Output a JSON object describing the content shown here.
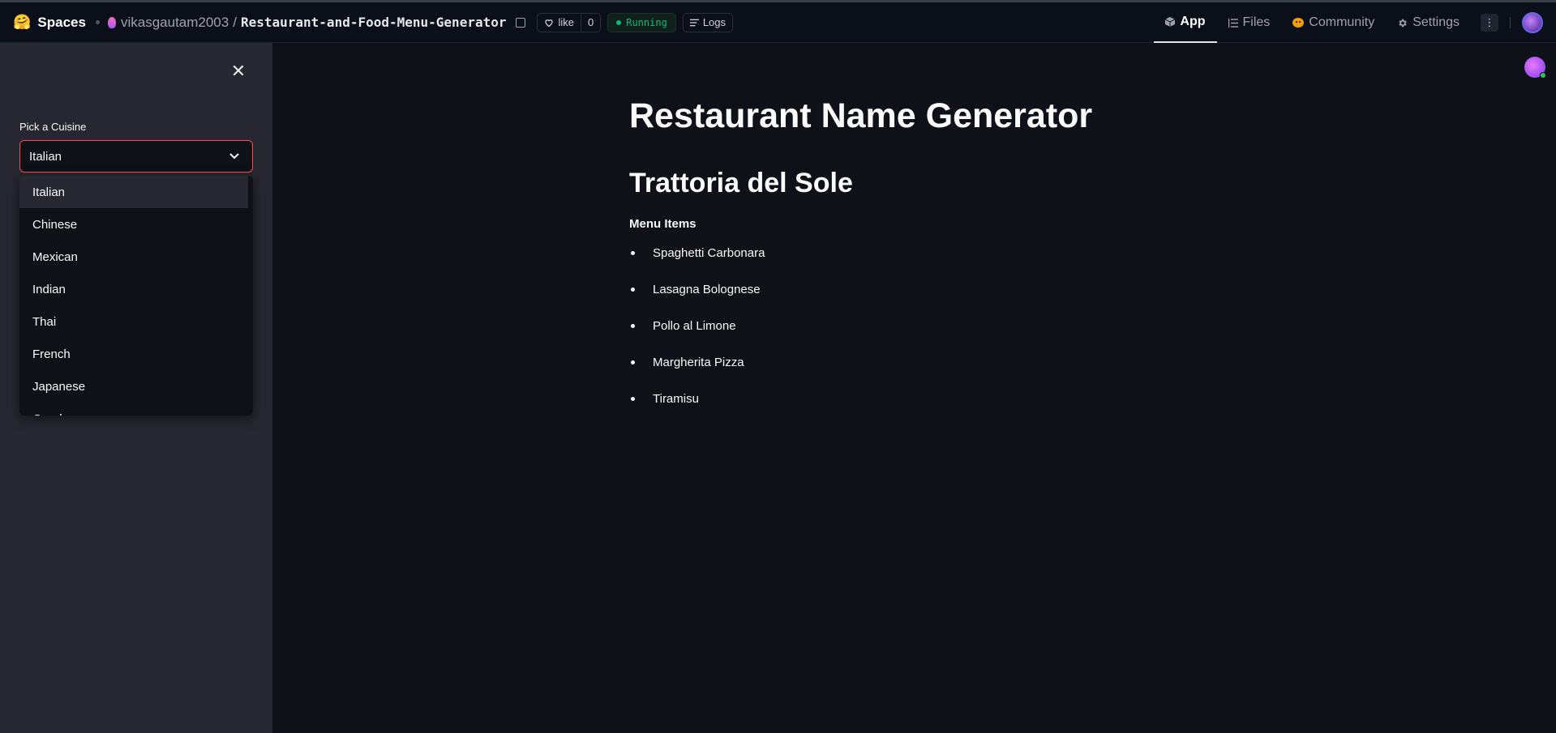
{
  "topbar": {
    "brand": "Spaces",
    "owner": "vikasgautam2003",
    "slash": "/",
    "repo_name": "Restaurant-and-Food-Menu-Generator",
    "like_label": "like",
    "like_count": "0",
    "status": "Running",
    "logs_label": "Logs",
    "tabs": [
      {
        "label": "App",
        "icon": "cube-icon"
      },
      {
        "label": "Files",
        "icon": "files-icon"
      },
      {
        "label": "Community",
        "icon": "community-icon"
      },
      {
        "label": "Settings",
        "icon": "gear-icon"
      }
    ],
    "more_label": "⋮"
  },
  "sidebar": {
    "select_label": "Pick a Cuisine",
    "selected_value": "Italian",
    "options": [
      "Italian",
      "Chinese",
      "Mexican",
      "Indian",
      "Thai",
      "French",
      "Japanese",
      "Greek"
    ]
  },
  "main": {
    "title": "Restaurant Name Generator",
    "restaurant_name": "Trattoria del Sole",
    "menu_title": "Menu Items",
    "menu_items": [
      "Spaghetti Carbonara",
      "Lasagna Bolognese",
      "Pollo al Limone",
      "Margherita Pizza",
      "Tiramisu"
    ]
  },
  "colors": {
    "accent": "#ff4b4b",
    "status_green": "#10b981",
    "background": "#0e1117",
    "sidebar": "#262730"
  }
}
